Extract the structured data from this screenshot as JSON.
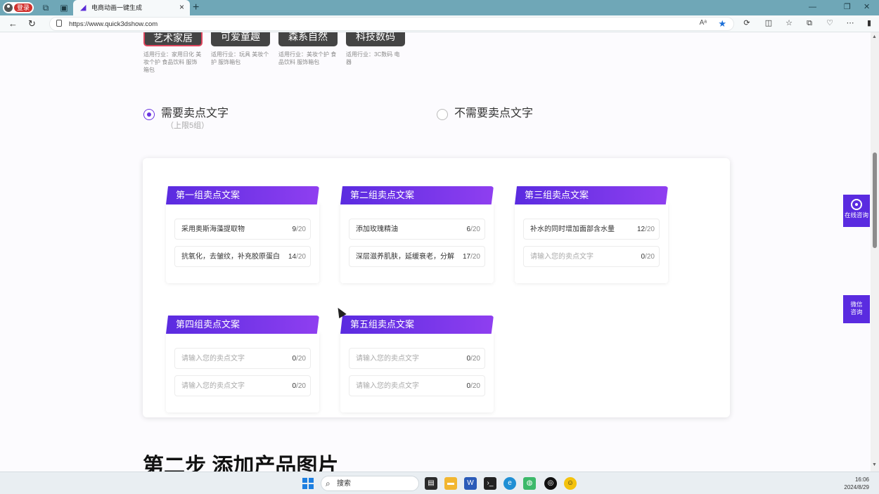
{
  "browser": {
    "profile_label": "登录",
    "tab_title": "电商动画一键生成",
    "url": "https://www.quick3dshow.com"
  },
  "styles": [
    {
      "name": "艺术家居",
      "desc": "适用行业：家用日化 美妆个护 食品饮料 服饰箱包",
      "selected": true
    },
    {
      "name": "可爱童趣",
      "desc": "适用行业：玩具 美妆个护 服饰箱包",
      "selected": false
    },
    {
      "name": "森系自然",
      "desc": "适用行业：美妆个护 食品饮料 服饰箱包",
      "selected": false
    },
    {
      "name": "科技数码",
      "desc": "适用行业：3C数码 电器",
      "selected": false
    }
  ],
  "options": {
    "need_label": "需要卖点文字",
    "need_sub": "（上限5组）",
    "no_need_label": "不需要卖点文字",
    "selected": "need"
  },
  "groups": [
    {
      "title": "第一组卖点文案",
      "fields": [
        {
          "text": "采用奥斯海藻提取物",
          "count": "9",
          "max": "/20",
          "placeholder": false
        },
        {
          "text": "抗氧化，去皱纹，补充胶原蛋白",
          "count": "14",
          "max": "/20",
          "placeholder": false
        }
      ]
    },
    {
      "title": "第二组卖点文案",
      "fields": [
        {
          "text": "添加玫瑰精油",
          "count": "6",
          "max": "/20",
          "placeholder": false
        },
        {
          "text": "深层滋养肌肤，延缓衰老，分解",
          "count": "17",
          "max": "/20",
          "placeholder": false
        }
      ]
    },
    {
      "title": "第三组卖点文案",
      "fields": [
        {
          "text": "补水的同时增加面部含水量",
          "count": "12",
          "max": "/20",
          "placeholder": false
        },
        {
          "text": "请输入您的卖点文字",
          "count": "0",
          "max": "/20",
          "placeholder": true
        }
      ]
    },
    {
      "title": "第四组卖点文案",
      "fields": [
        {
          "text": "请输入您的卖点文字",
          "count": "0",
          "max": "/20",
          "placeholder": true
        },
        {
          "text": "请输入您的卖点文字",
          "count": "0",
          "max": "/20",
          "placeholder": true
        }
      ]
    },
    {
      "title": "第五组卖点文案",
      "fields": [
        {
          "text": "请输入您的卖点文字",
          "count": "0",
          "max": "/20",
          "placeholder": true
        },
        {
          "text": "请输入您的卖点文字",
          "count": "0",
          "max": "/20",
          "placeholder": true
        }
      ]
    }
  ],
  "float_buttons": {
    "online": "在线咨询",
    "wechat_line1": "微信",
    "wechat_line2": "咨询"
  },
  "step_title": "第二步 添加产品图片",
  "taskbar": {
    "search_label": "搜索",
    "time": "16:06",
    "date": "2024/8/29"
  },
  "colors": {
    "accent": "#5a2be0",
    "chip": "#444444",
    "chip_selected_border": "#e0465f"
  }
}
